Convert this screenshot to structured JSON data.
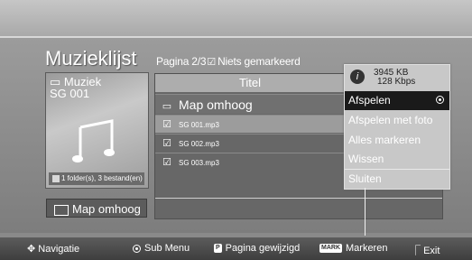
{
  "page": {
    "title": "Muzieklijst",
    "pager": "Pagina 2/3",
    "marked": "Niets gemarkeerd"
  },
  "album": {
    "category": "Muziek",
    "device": "SG 001",
    "summary": "1 folder(s), 3 bestand(en)"
  },
  "left_button": "Map omhoog",
  "list": {
    "column_title": "Titel",
    "up_label": "Map omhoog",
    "rows": [
      "SG 001.mp3",
      "SG 002.mp3",
      "SG 003.mp3"
    ]
  },
  "popup": {
    "size": "3945 KB",
    "bitrate": "128 Kbps",
    "items": [
      "Afspelen",
      "Afspelen met foto",
      "Alles markeren",
      "Wissen",
      "Sluiten"
    ]
  },
  "footer": {
    "nav": "Navigatie",
    "sub": "Sub Menu",
    "page": "Pagina gewijzigd",
    "mark_key": "MARK",
    "mark": "Markeren",
    "exit": "Exit"
  },
  "colors": {
    "selected_item": "#1a1a1a",
    "header_bar": "#adadad"
  }
}
